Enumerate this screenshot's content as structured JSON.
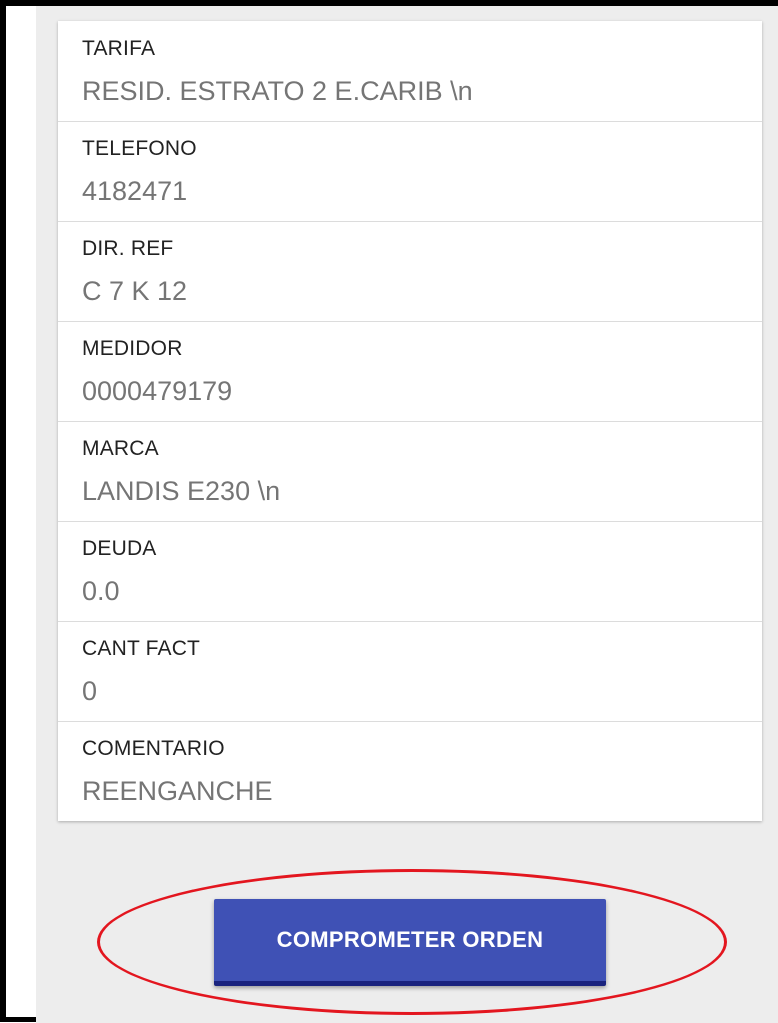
{
  "fields": [
    {
      "label": "TARIFA",
      "value": "RESID. ESTRATO 2 E.CARIB \\n"
    },
    {
      "label": "TELEFONO",
      "value": "4182471"
    },
    {
      "label": "DIR. REF",
      "value": "C 7 K 12"
    },
    {
      "label": "MEDIDOR",
      "value": "0000479179"
    },
    {
      "label": "MARCA",
      "value": "LANDIS E230 \\n"
    },
    {
      "label": "DEUDA",
      "value": "0.0"
    },
    {
      "label": "CANT FACT",
      "value": "0"
    },
    {
      "label": "COMENTARIO",
      "value": "REENGANCHE"
    }
  ],
  "action": {
    "button_label": "COMPROMETER ORDEN",
    "button_color": "#3f51b5",
    "highlight_color": "#e3161f"
  }
}
